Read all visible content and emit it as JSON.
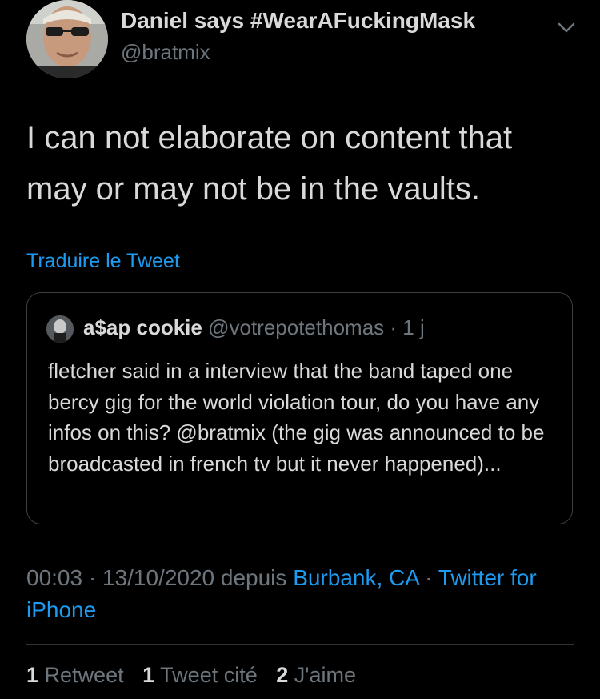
{
  "tweet": {
    "author_name": "Daniel says #WearAFuckingMask",
    "author_handle": "@bratmix",
    "text": "I can not elaborate on content that may or may not be in the vaults.",
    "translate_label": "Traduire le Tweet",
    "options_icon": "chevron-down-icon"
  },
  "quoted": {
    "name": "a$ap cookie",
    "handle": "@votrepotethomas",
    "time": "1 j",
    "text": "fletcher said in a interview that the band taped one bercy gig for the world violation tour, do you have any infos on this? @bratmix (the gig was announced to be broadcasted in french tv but it never happened)..."
  },
  "meta": {
    "time": "00:03",
    "date": "13/10/2020",
    "via_label": "depuis",
    "location": "Burbank, CA",
    "client": "Twitter for iPhone"
  },
  "stats": {
    "retweets_count": "1",
    "retweets_label": "Retweet",
    "quotes_count": "1",
    "quotes_label": "Tweet cité",
    "likes_count": "2",
    "likes_label": "J'aime"
  },
  "colors": {
    "background": "#000000",
    "text": "#d9d9d9",
    "secondary": "#6e767d",
    "link": "#1d9bf0",
    "border": "#2f3336"
  }
}
